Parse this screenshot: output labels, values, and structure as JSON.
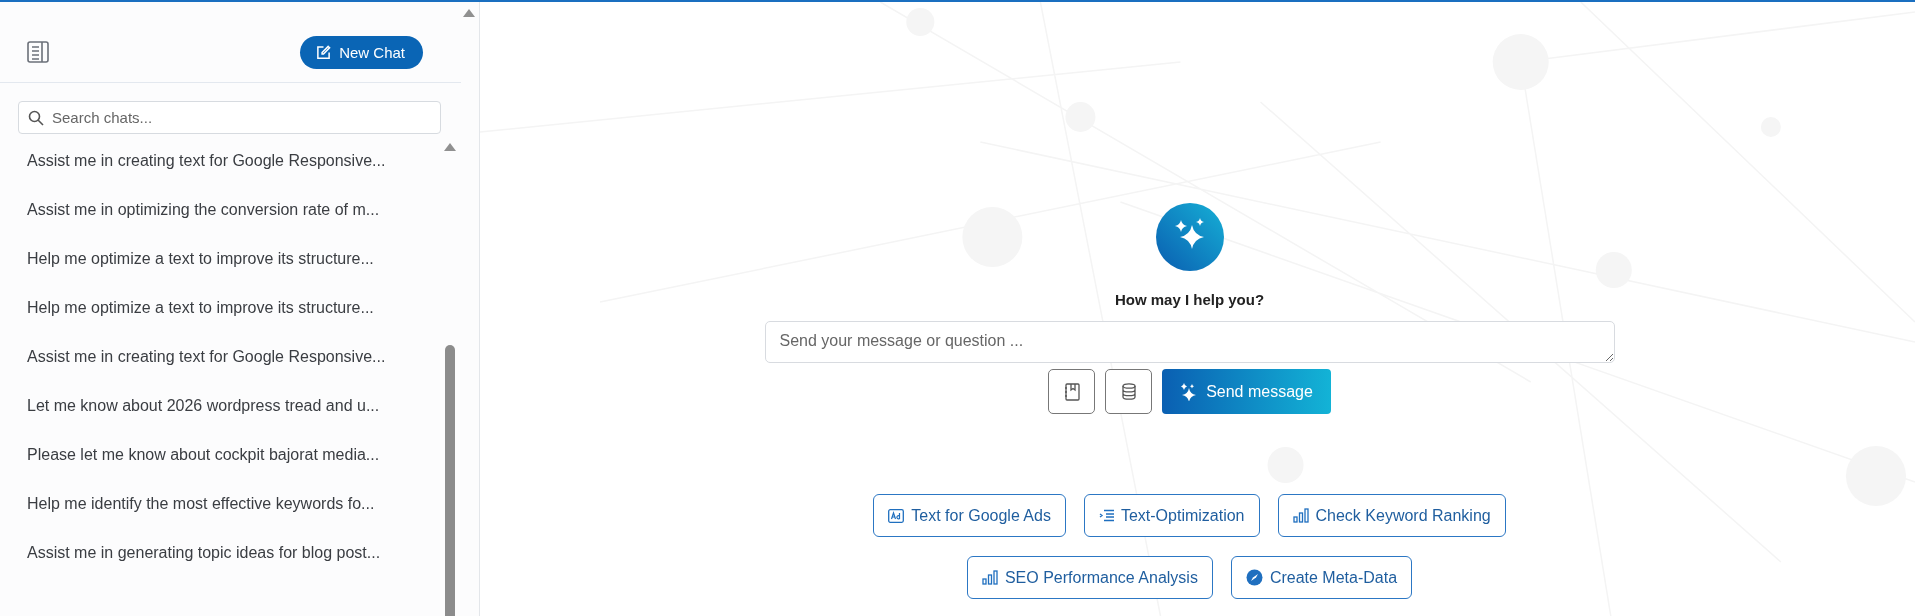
{
  "sidebar": {
    "new_chat_button": "New Chat",
    "search": {
      "placeholder": "Search chats..."
    },
    "chats": [
      {
        "title": "Assist me in creating text for Google Responsive..."
      },
      {
        "title": "Assist me in optimizing the conversion rate of m..."
      },
      {
        "title": "Help me optimize a text to improve its structure..."
      },
      {
        "title": "Help me optimize a text to improve its structure..."
      },
      {
        "title": "Assist me in creating text for Google Responsive..."
      },
      {
        "title": "Let me know about 2026 wordpress tread and u..."
      },
      {
        "title": "Please let me know about cockpit bajorat media..."
      },
      {
        "title": "Help me identify the most effective keywords fo..."
      },
      {
        "title": "Assist me in generating topic ideas for blog post..."
      }
    ]
  },
  "main": {
    "title": "How may I help you?",
    "message": {
      "placeholder": "Send your message or question ..."
    },
    "send_button": "Send message",
    "suggestion_rows": [
      [
        {
          "label": "Text for Google Ads",
          "kind": "ad"
        },
        {
          "label": "Text-Optimization",
          "kind": "text"
        },
        {
          "label": "Check Keyword Ranking",
          "kind": "ranking"
        }
      ],
      [
        {
          "label": "SEO Performance Analysis",
          "kind": "ranking"
        },
        {
          "label": "Create Meta-Data",
          "kind": "meta"
        }
      ]
    ]
  }
}
